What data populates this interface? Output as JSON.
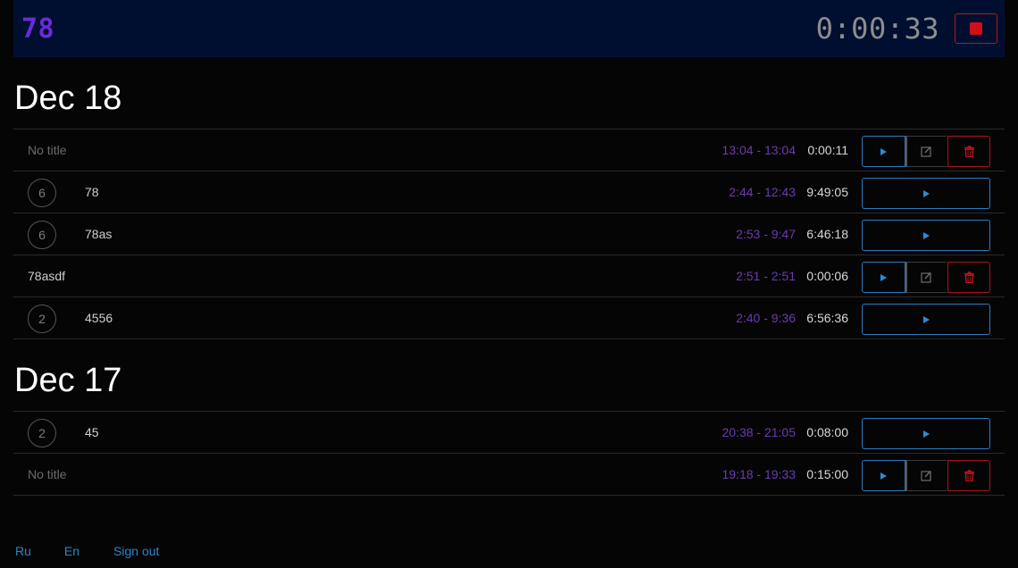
{
  "header": {
    "current_task": "78",
    "timer": "0:00:33"
  },
  "days": [
    {
      "date": "Dec 18",
      "entries": [
        {
          "count": null,
          "title": "No title",
          "empty_title": true,
          "range": "13:04 - 13:04",
          "duration": "0:00:11",
          "controls": "full"
        },
        {
          "count": "6",
          "title": "78",
          "empty_title": false,
          "range": "2:44 - 12:43",
          "duration": "9:49:05",
          "controls": "play"
        },
        {
          "count": "6",
          "title": "78as",
          "empty_title": false,
          "range": "2:53 - 9:47",
          "duration": "6:46:18",
          "controls": "play"
        },
        {
          "count": null,
          "title": "78asdf",
          "empty_title": false,
          "range": "2:51 - 2:51",
          "duration": "0:00:06",
          "controls": "full"
        },
        {
          "count": "2",
          "title": "4556",
          "empty_title": false,
          "range": "2:40 - 9:36",
          "duration": "6:56:36",
          "controls": "play"
        }
      ]
    },
    {
      "date": "Dec 17",
      "entries": [
        {
          "count": "2",
          "title": "45",
          "empty_title": false,
          "range": "20:38 - 21:05",
          "duration": "0:08:00",
          "controls": "play"
        },
        {
          "count": null,
          "title": "No title",
          "empty_title": true,
          "range": "19:18 - 19:33",
          "duration": "0:15:00",
          "controls": "full"
        }
      ]
    }
  ],
  "footer": {
    "lang_ru": "Ru",
    "lang_en": "En",
    "sign_out": "Sign out"
  },
  "icons": {
    "stop": "stop-square-icon",
    "play": "play-triangle-icon",
    "edit": "pencil-square-icon",
    "delete": "trash-icon"
  },
  "colors": {
    "header_bg": "#000f30",
    "accent_purple": "#6a2bd9",
    "range_purple": "#6a3bb0",
    "play_blue": "#2c7ac0",
    "danger_red": "#b5141b",
    "link_blue": "#2c86c9"
  }
}
